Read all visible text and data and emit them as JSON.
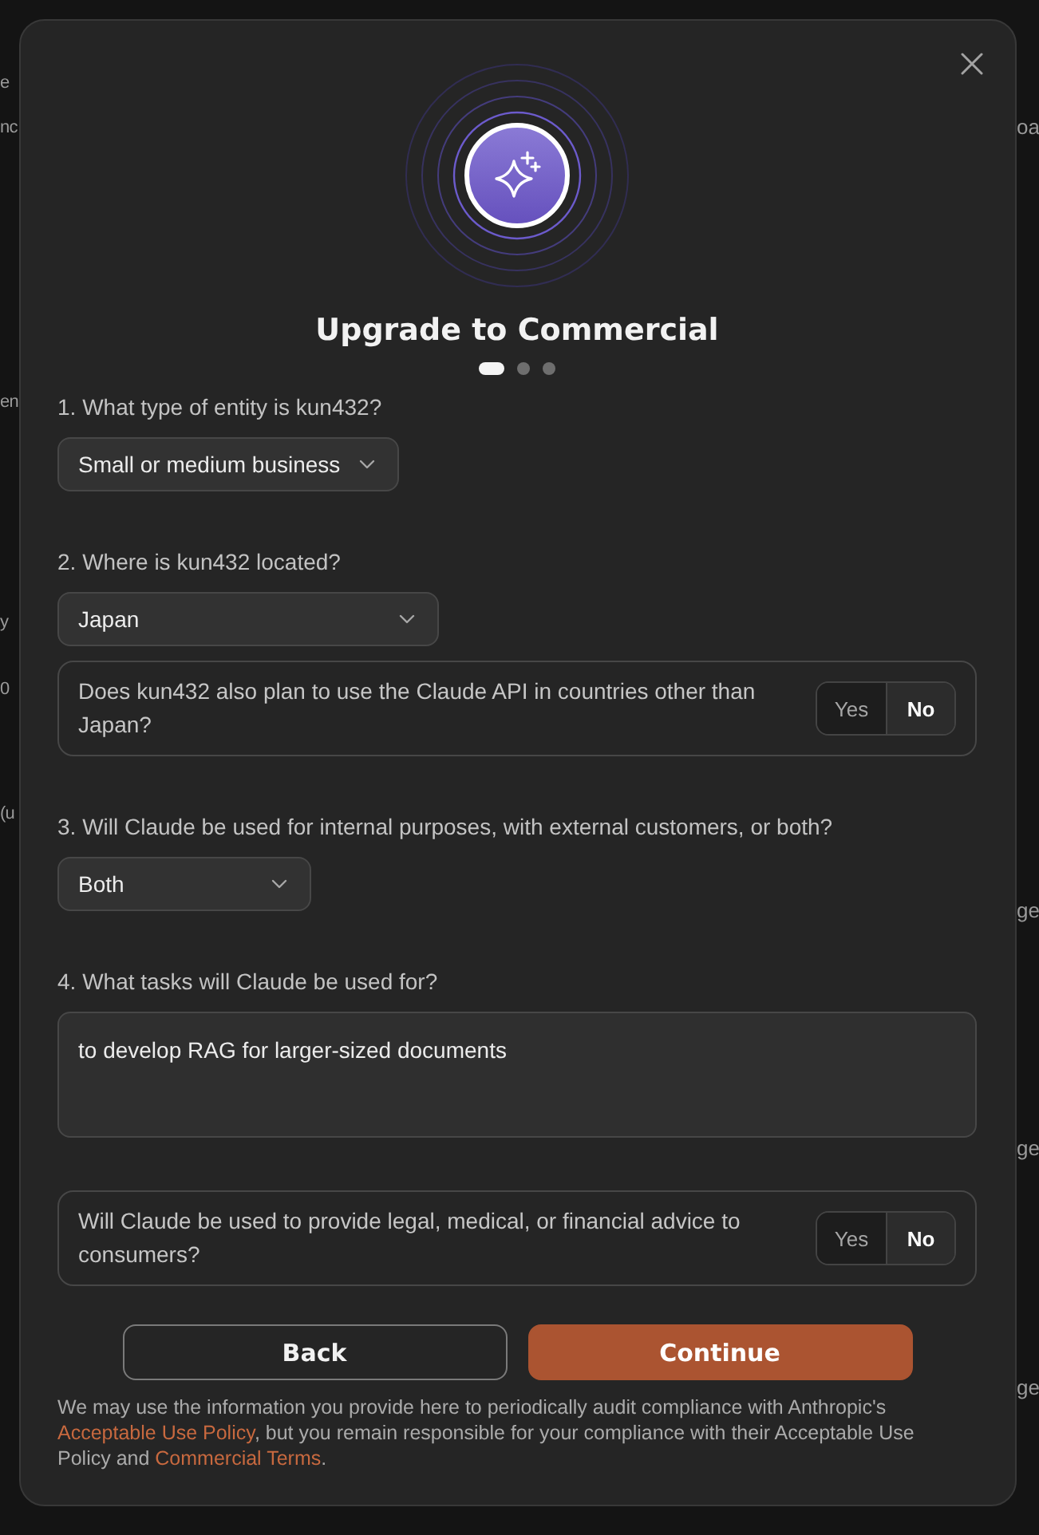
{
  "background": {
    "left_fragments": [
      "e",
      "nc",
      "en",
      "y",
      "0",
      "(u"
    ],
    "right_fragments": [
      "oa",
      "ge",
      "ge",
      "ge"
    ]
  },
  "dialog": {
    "title": "Upgrade to Commercial",
    "steps": [
      {
        "selected": true
      },
      {
        "selected": false
      },
      {
        "selected": false
      }
    ],
    "questions": [
      {
        "kind": "select",
        "label": "1. What type of entity is kun432?",
        "value": "Small or medium business"
      },
      {
        "kind": "select",
        "label": "2. Where is kun432 located?",
        "value": "Japan"
      },
      {
        "kind": "yes_no",
        "text": "Does kun432 also plan to use the Claude API in countries other than Japan?",
        "options": [
          {
            "label": "Yes",
            "selected": false
          },
          {
            "label": "No",
            "selected": true
          }
        ]
      },
      {
        "kind": "select",
        "label": "3. Will Claude be used for internal purposes, with external customers, or both?",
        "value": "Both"
      },
      {
        "kind": "textarea",
        "label": "4. What tasks will Claude be used for?",
        "value": "to develop RAG for larger-sized documents"
      },
      {
        "kind": "yes_no",
        "text": "Will Claude be used to provide legal, medical, or financial advice to consumers?",
        "options": [
          {
            "label": "Yes",
            "selected": false
          },
          {
            "label": "No",
            "selected": true
          }
        ]
      }
    ],
    "buttons": [
      {
        "kind": "secondary",
        "label": "Back"
      },
      {
        "kind": "primary",
        "label": "Continue"
      }
    ],
    "disclaimer": [
      {
        "text": "We may use the information you provide here to periodically audit compliance with Anthropic's "
      },
      {
        "kind": "link",
        "text": "Acceptable Use Policy"
      },
      {
        "text": ", but you remain responsible for your compliance with their Acceptable Use Policy and "
      },
      {
        "kind": "link",
        "text": "Commercial Terms"
      },
      {
        "text": "."
      }
    ]
  }
}
